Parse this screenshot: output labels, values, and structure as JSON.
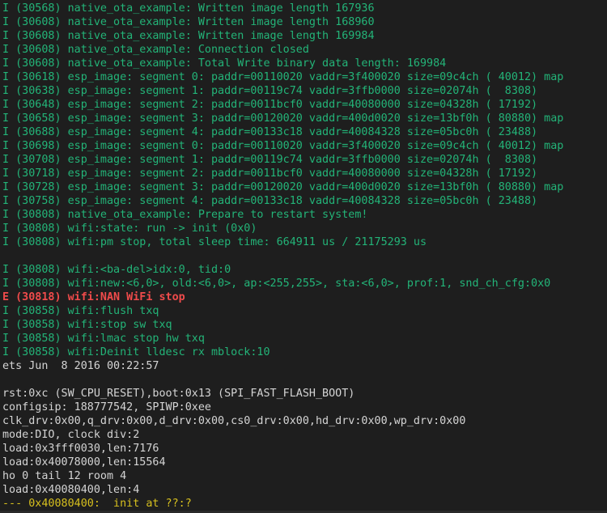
{
  "colors": {
    "background": "#1e1e1e",
    "info": "#23b478",
    "error": "#f04b4b",
    "plain": "#d4d4d4",
    "warn": "#d7c01e"
  },
  "lines": [
    {
      "text": "I (30568) native_ota_example: Written image length 167936",
      "style": "green"
    },
    {
      "text": "I (30608) native_ota_example: Written image length 168960",
      "style": "green"
    },
    {
      "text": "I (30608) native_ota_example: Written image length 169984",
      "style": "green"
    },
    {
      "text": "I (30608) native_ota_example: Connection closed",
      "style": "green"
    },
    {
      "text": "I (30608) native_ota_example: Total Write binary data length: 169984",
      "style": "green"
    },
    {
      "text": "I (30618) esp_image: segment 0: paddr=00110020 vaddr=3f400020 size=09c4ch ( 40012) map",
      "style": "green"
    },
    {
      "text": "I (30638) esp_image: segment 1: paddr=00119c74 vaddr=3ffb0000 size=02074h (  8308)",
      "style": "green"
    },
    {
      "text": "I (30648) esp_image: segment 2: paddr=0011bcf0 vaddr=40080000 size=04328h ( 17192)",
      "style": "green"
    },
    {
      "text": "I (30658) esp_image: segment 3: paddr=00120020 vaddr=400d0020 size=13bf0h ( 80880) map",
      "style": "green"
    },
    {
      "text": "I (30688) esp_image: segment 4: paddr=00133c18 vaddr=40084328 size=05bc0h ( 23488)",
      "style": "green"
    },
    {
      "text": "I (30698) esp_image: segment 0: paddr=00110020 vaddr=3f400020 size=09c4ch ( 40012) map",
      "style": "green"
    },
    {
      "text": "I (30708) esp_image: segment 1: paddr=00119c74 vaddr=3ffb0000 size=02074h (  8308)",
      "style": "green"
    },
    {
      "text": "I (30718) esp_image: segment 2: paddr=0011bcf0 vaddr=40080000 size=04328h ( 17192)",
      "style": "green"
    },
    {
      "text": "I (30728) esp_image: segment 3: paddr=00120020 vaddr=400d0020 size=13bf0h ( 80880) map",
      "style": "green"
    },
    {
      "text": "I (30758) esp_image: segment 4: paddr=00133c18 vaddr=40084328 size=05bc0h ( 23488)",
      "style": "green"
    },
    {
      "text": "I (30808) native_ota_example: Prepare to restart system!",
      "style": "green"
    },
    {
      "text": "I (30808) wifi:state: run -> init (0x0)",
      "style": "green"
    },
    {
      "text": "I (30808) wifi:pm stop, total sleep time: 664911 us / 21175293 us",
      "style": "green"
    },
    {
      "text": "",
      "style": "blank"
    },
    {
      "text": "I (30808) wifi:<ba-del>idx:0, tid:0",
      "style": "green"
    },
    {
      "text": "I (30808) wifi:new:<6,0>, old:<6,0>, ap:<255,255>, sta:<6,0>, prof:1, snd_ch_cfg:0x0",
      "style": "green"
    },
    {
      "text": "E (30818) wifi:NAN WiFi stop",
      "style": "red"
    },
    {
      "text": "I (30858) wifi:flush txq",
      "style": "green"
    },
    {
      "text": "I (30858) wifi:stop sw txq",
      "style": "green"
    },
    {
      "text": "I (30858) wifi:lmac stop hw txq",
      "style": "green"
    },
    {
      "text": "I (30858) wifi:Deinit lldesc rx mblock:10",
      "style": "green"
    },
    {
      "text": "ets Jun  8 2016 00:22:57",
      "style": "white"
    },
    {
      "text": "",
      "style": "blank"
    },
    {
      "text": "rst:0xc (SW_CPU_RESET),boot:0x13 (SPI_FAST_FLASH_BOOT)",
      "style": "white"
    },
    {
      "text": "configsip: 188777542, SPIWP:0xee",
      "style": "white"
    },
    {
      "text": "clk_drv:0x00,q_drv:0x00,d_drv:0x00,cs0_drv:0x00,hd_drv:0x00,wp_drv:0x00",
      "style": "white"
    },
    {
      "text": "mode:DIO, clock div:2",
      "style": "white"
    },
    {
      "text": "load:0x3fff0030,len:7176",
      "style": "white"
    },
    {
      "text": "load:0x40078000,len:15564",
      "style": "white"
    },
    {
      "text": "ho 0 tail 12 room 4",
      "style": "white"
    },
    {
      "text": "load:0x40080400,len:4",
      "style": "white"
    },
    {
      "text": "--- 0x40080400:  init at ??:?",
      "style": "yellow"
    }
  ]
}
